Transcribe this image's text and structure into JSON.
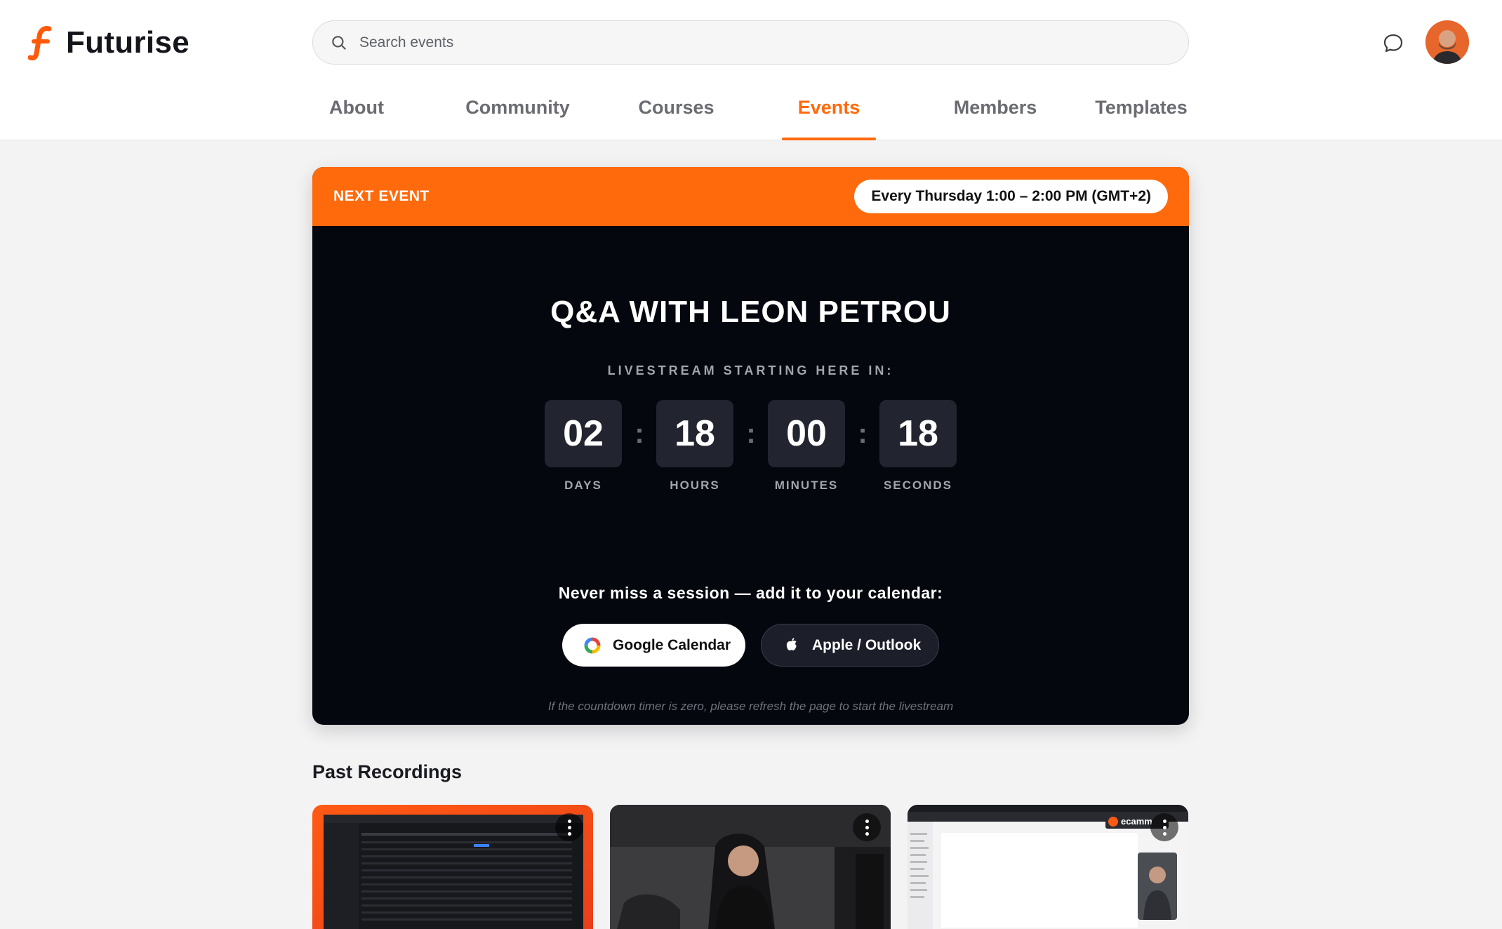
{
  "brand": {
    "name": "Futurise",
    "accent": "#ff6a0c"
  },
  "search": {
    "placeholder": "Search events",
    "icon": "search-icon"
  },
  "header_actions": {
    "chat_icon": "chat-bubble-icon",
    "avatar": "user-avatar"
  },
  "nav": {
    "tabs": [
      {
        "label": "About",
        "active": false
      },
      {
        "label": "Community",
        "active": false
      },
      {
        "label": "Courses",
        "active": false
      },
      {
        "label": "Events",
        "active": true
      },
      {
        "label": "Members",
        "active": false
      },
      {
        "label": "Templates",
        "active": false
      }
    ]
  },
  "next_event": {
    "label": "NEXT EVENT",
    "schedule": "Every Thursday 1:00 – 2:00 PM (GMT+2)",
    "title": "Q&A WITH LEON PETROU",
    "countdown_label": "LIVESTREAM STARTING HERE IN:",
    "countdown": {
      "days": {
        "value": "02",
        "label": "DAYS"
      },
      "hours": {
        "value": "18",
        "label": "HOURS"
      },
      "minutes": {
        "value": "00",
        "label": "MINUTES"
      },
      "seconds": {
        "value": "18",
        "label": "SECONDS"
      }
    },
    "calendar_prompt": "Never miss a session — add it to your calendar:",
    "google_calendar_label": "Google Calendar",
    "apple_outlook_label": "Apple / Outlook",
    "refresh_note": "If the countdown timer is zero, please refresh the page to start the livestream"
  },
  "past_recordings": {
    "title": "Past Recordings",
    "items": [
      {
        "thumbnail": "screen-recording-thumbnail"
      },
      {
        "thumbnail": "presenter-video-thumbnail"
      },
      {
        "thumbnail": "screen-share-thumbnail",
        "overlay_text": "ecamm"
      }
    ]
  }
}
